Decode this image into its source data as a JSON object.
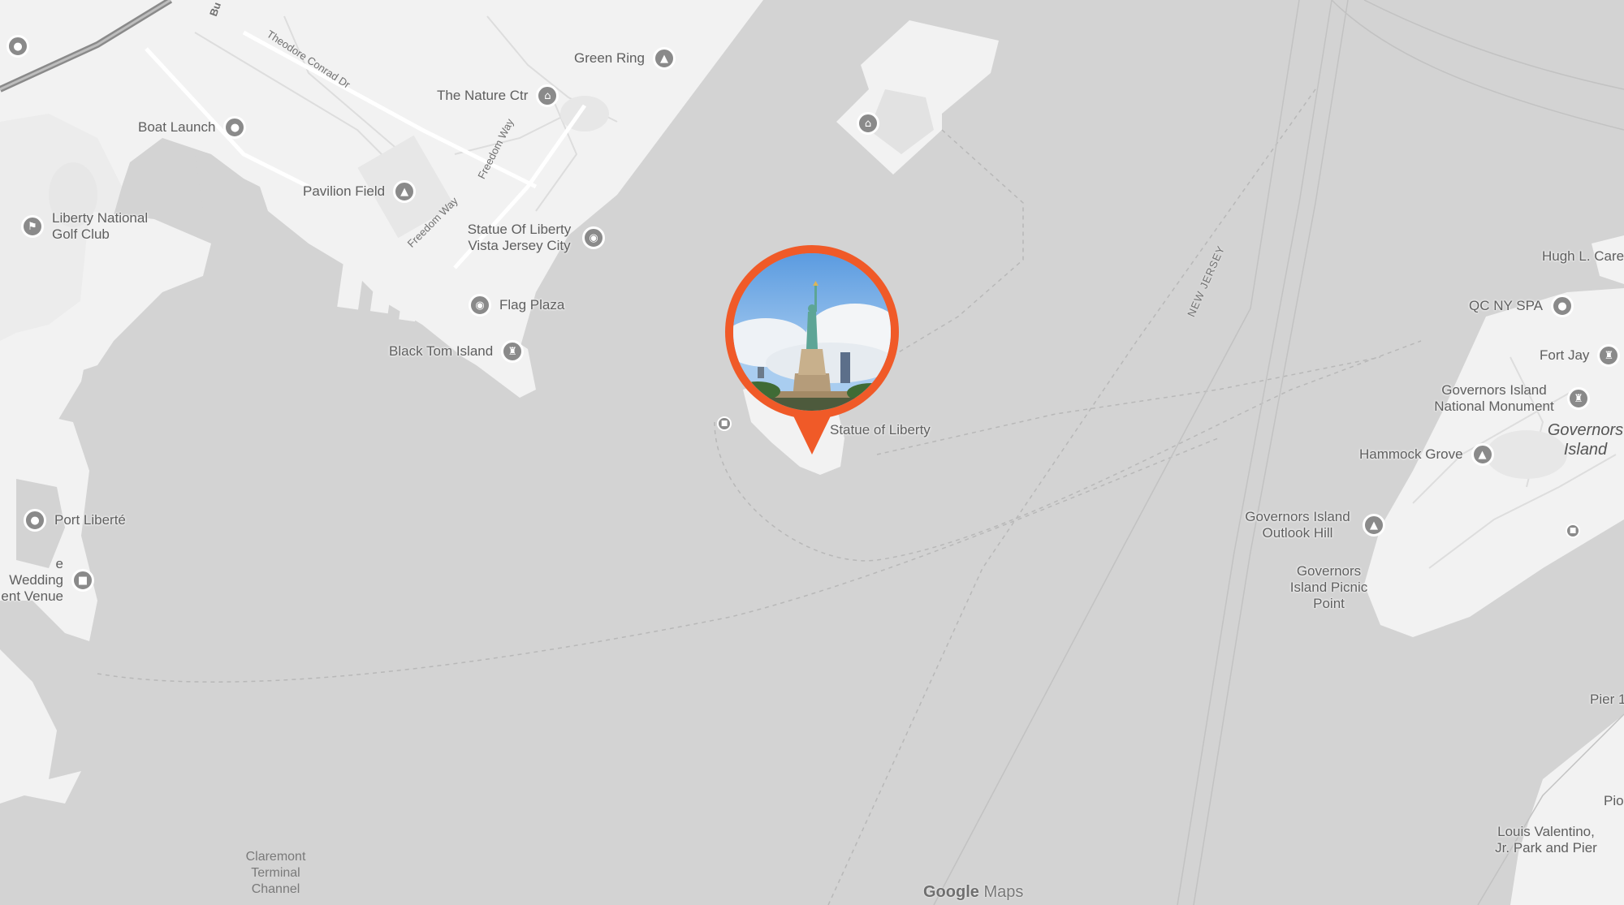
{
  "map": {
    "attribution_brand": "Google",
    "attribution_product": "Maps",
    "colors": {
      "water": "#d3d3d3",
      "land": "#f2f2f2",
      "marker": "#f05a28",
      "pin": "#8a8a8a"
    }
  },
  "marker": {
    "label": "Statue of Liberty",
    "photo_subject": "statue-of-liberty-photo"
  },
  "pois": {
    "green_ring": "Green Ring",
    "nature_ctr": "The Nature Ctr",
    "boat_launch": "Boat Launch",
    "pavilion_field": "Pavilion Field",
    "liberty_golf": "Liberty National Golf Club",
    "statue_vista": "Statue Of Liberty Vista Jersey City",
    "flag_plaza": "Flag Plaza",
    "black_tom": "Black Tom Island",
    "port_liberte": "Port Liberté",
    "wedding_venue": "e Wedding ent Venue",
    "hugh_carey": "Hugh L. Care",
    "qc_spa": "QC NY SPA",
    "fort_jay": "Fort Jay",
    "governors_monument": "Governors Island National Monument",
    "hammock_grove": "Hammock Grove",
    "outlook_hill": "Governors Island Outlook Hill",
    "picnic_point": "Governors Island Picnic Point",
    "pier": "Pier 1",
    "pio": "Pio",
    "louis_valentino": "Louis Valentino, Jr. Park and Pier"
  },
  "roads": {
    "theodore_conrad": "Theodore Conrad Dr",
    "freedom_way_1": "Freedom Way",
    "freedom_way_2": "Freedom Way",
    "new_jersey": "NEW JERSEY",
    "bu": "Bu"
  },
  "water": {
    "claremont": "Claremont Terminal Channel"
  },
  "islands": {
    "governors": "Governors Island"
  }
}
